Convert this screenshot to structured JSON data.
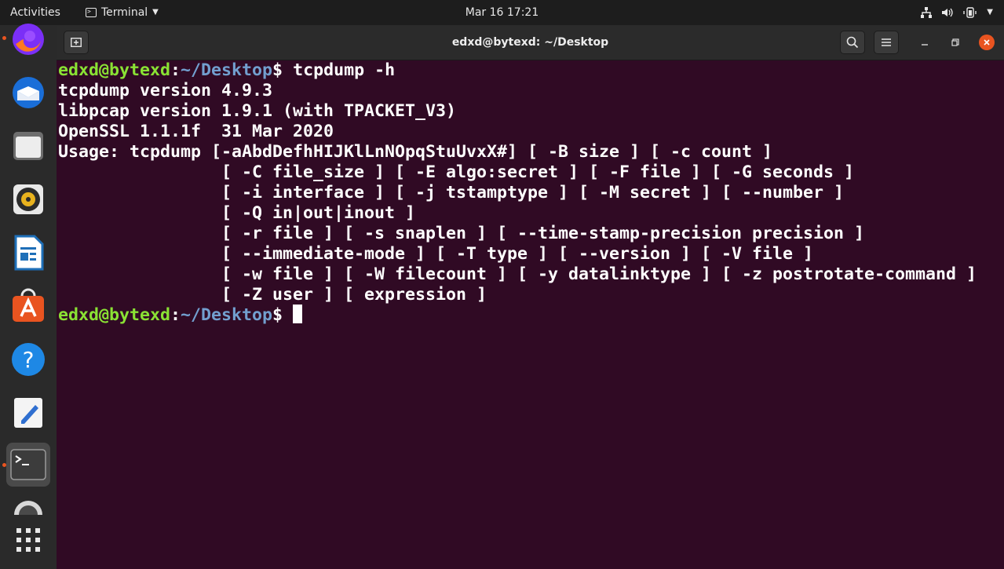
{
  "topbar": {
    "activities": "Activities",
    "app_menu": "Terminal",
    "clock": "Mar 16  17:21"
  },
  "dock": {
    "items": [
      {
        "name": "firefox",
        "running": true
      },
      {
        "name": "thunderbird"
      },
      {
        "name": "files"
      },
      {
        "name": "rhythmbox"
      },
      {
        "name": "libreoffice-writer"
      },
      {
        "name": "ubuntu-software"
      },
      {
        "name": "help"
      },
      {
        "name": "text-editor"
      },
      {
        "name": "terminal",
        "running": true,
        "active": true
      },
      {
        "name": "software-updater"
      },
      {
        "name": "show-applications"
      }
    ]
  },
  "window": {
    "title": "edxd@bytexd: ~/Desktop"
  },
  "terminal": {
    "prompt_user": "edxd@bytexd",
    "prompt_sep": ":",
    "prompt_path": "~/Desktop",
    "prompt_end": "$ ",
    "command": "tcpdump -h",
    "output": [
      "tcpdump version 4.9.3",
      "libpcap version 1.9.1 (with TPACKET_V3)",
      "OpenSSL 1.1.1f  31 Mar 2020",
      "Usage: tcpdump [-aAbdDefhHIJKlLnNOpqStuUvxX#] [ -B size ] [ -c count ]",
      "                [ -C file_size ] [ -E algo:secret ] [ -F file ] [ -G seconds ]",
      "                [ -i interface ] [ -j tstamptype ] [ -M secret ] [ --number ]",
      "                [ -Q in|out|inout ]",
      "                [ -r file ] [ -s snaplen ] [ --time-stamp-precision precision ]",
      "                [ --immediate-mode ] [ -T type ] [ --version ] [ -V file ]",
      "                [ -w file ] [ -W filecount ] [ -y datalinktype ] [ -z postrotate-command ]",
      "                [ -Z user ] [ expression ]"
    ]
  },
  "colors": {
    "terminal_bg": "#300a24",
    "prompt_user": "#8ae234",
    "prompt_path": "#729fcf",
    "accent": "#e95420"
  }
}
